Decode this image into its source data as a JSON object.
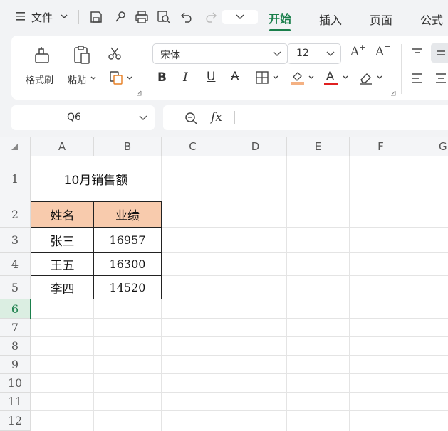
{
  "menu": {
    "file_label": "文件",
    "tabs": [
      {
        "label": "开始",
        "active": true
      },
      {
        "label": "插入",
        "active": false
      },
      {
        "label": "页面",
        "active": false
      },
      {
        "label": "公式",
        "active": false
      }
    ]
  },
  "ribbon": {
    "format_painter_label": "格式刷",
    "paste_label": "粘贴",
    "font_name": "宋体",
    "font_size": "12",
    "bold_glyph": "B",
    "italic_glyph": "I",
    "underline_glyph": "U",
    "strike_glyph": "A",
    "font_color_glyph": "A",
    "grow_glyph": "A",
    "shrink_glyph": "A"
  },
  "formula_bar": {
    "name_box": "Q6",
    "fx_label": "fx",
    "value": ""
  },
  "sheet": {
    "columns": [
      "A",
      "B",
      "C",
      "D",
      "E",
      "F",
      "G"
    ],
    "rows": [
      "1",
      "2",
      "3",
      "4",
      "5",
      "6",
      "7",
      "8",
      "9",
      "10",
      "11",
      "12"
    ],
    "title": "10月销售额",
    "header_name": "姓名",
    "header_perf": "业绩",
    "data": [
      {
        "name": "张三",
        "value": "16957"
      },
      {
        "name": "王五",
        "value": "16300"
      },
      {
        "name": "李四",
        "value": "14520"
      }
    ],
    "header_fill": "#f8cbad",
    "active_row": "6"
  },
  "colors": {
    "accent": "#1a7f4b",
    "font_color_bar": "#e02020",
    "fill_color_bar": "#f4b183"
  }
}
